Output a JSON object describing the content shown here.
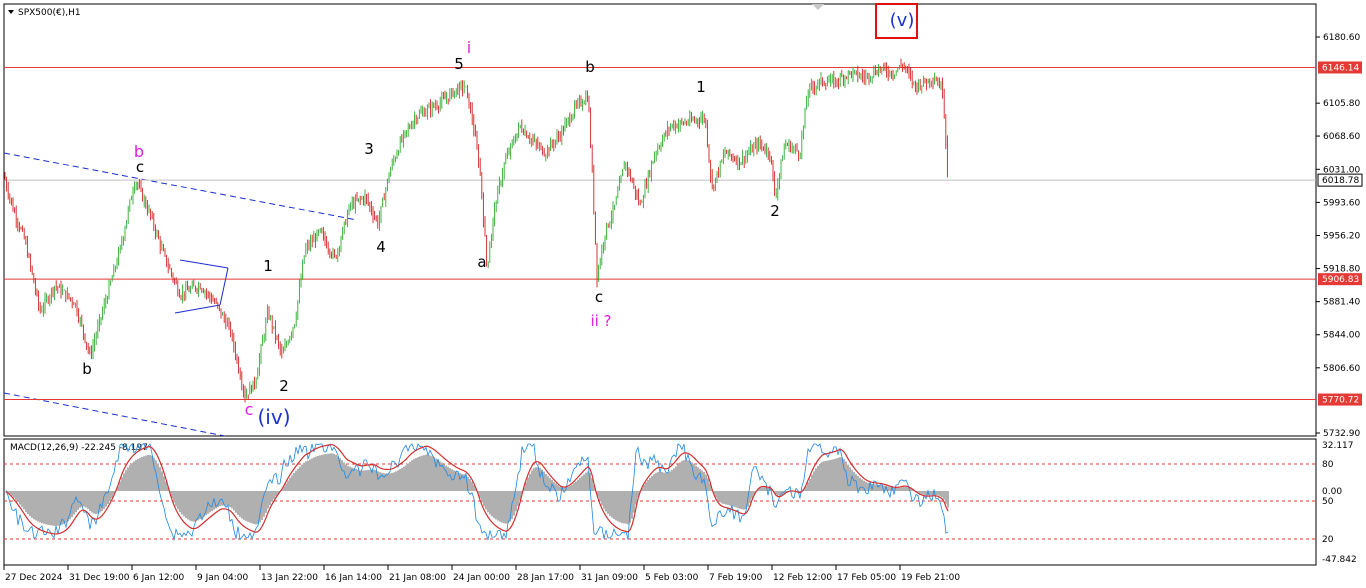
{
  "chart_data": {
    "type": "candlestick",
    "title": "SPX500(€),H1",
    "ylim": [
      5732.9,
      6218.0
    ],
    "y_ticks": [
      "6180.60",
      "6105.80",
      "6068.60",
      "6031.00",
      "5993.60",
      "5956.20",
      "5918.80",
      "5881.40",
      "5844.00",
      "5806.60",
      "5732.90"
    ],
    "y_tick_values": [
      6180.6,
      6105.8,
      6068.6,
      6031.0,
      5993.6,
      5956.2,
      5918.8,
      5881.4,
      5844.0,
      5806.6,
      5732.9
    ],
    "x_labels": [
      "27 Dec 2024",
      "31 Dec 19:00",
      "6 Jan 12:00",
      "9 Jan 04:00",
      "13 Jan 22:00",
      "16 Jan 14:00",
      "21 Jan 08:00",
      "24 Jan 00:00",
      "28 Jan 17:00",
      "31 Jan 09:00",
      "5 Feb 03:00",
      "7 Feb 19:00",
      "12 Feb 12:00",
      "17 Feb 05:00",
      "19 Feb 21:00"
    ],
    "horizontal_levels": [
      {
        "value": 6146.14,
        "label": "6146.14",
        "color": "#e53935"
      },
      {
        "value": 5906.83,
        "label": "5906.83",
        "color": "#e53935"
      },
      {
        "value": 5770.72,
        "label": "5770.72",
        "color": "#e53935"
      }
    ],
    "current_price": {
      "value": 6018.78,
      "label": "6018.78"
    },
    "price_path_approx": [
      [
        0,
        6040
      ],
      [
        12,
        5990
      ],
      [
        25,
        5950
      ],
      [
        40,
        5870
      ],
      [
        55,
        5900
      ],
      [
        75,
        5880
      ],
      [
        90,
        5820
      ],
      [
        105,
        5880
      ],
      [
        120,
        5940
      ],
      [
        135,
        6020
      ],
      [
        150,
        5980
      ],
      [
        165,
        5930
      ],
      [
        180,
        5890
      ],
      [
        200,
        5900
      ],
      [
        215,
        5880
      ],
      [
        230,
        5850
      ],
      [
        245,
        5775
      ],
      [
        255,
        5790
      ],
      [
        268,
        5870
      ],
      [
        282,
        5820
      ],
      [
        295,
        5860
      ],
      [
        305,
        5940
      ],
      [
        320,
        5960
      ],
      [
        335,
        5930
      ],
      [
        350,
        5990
      ],
      [
        365,
        6000
      ],
      [
        378,
        5970
      ],
      [
        390,
        6030
      ],
      [
        400,
        6060
      ],
      [
        415,
        6090
      ],
      [
        430,
        6100
      ],
      [
        445,
        6110
      ],
      [
        455,
        6120
      ],
      [
        465,
        6125
      ],
      [
        472,
        6090
      ],
      [
        480,
        6030
      ],
      [
        487,
        5920
      ],
      [
        495,
        5990
      ],
      [
        505,
        6040
      ],
      [
        520,
        6080
      ],
      [
        535,
        6060
      ],
      [
        545,
        6050
      ],
      [
        560,
        6070
      ],
      [
        575,
        6100
      ],
      [
        588,
        6115
      ],
      [
        592,
        6030
      ],
      [
        597,
        5910
      ],
      [
        605,
        5960
      ],
      [
        615,
        5990
      ],
      [
        625,
        6040
      ],
      [
        640,
        5990
      ],
      [
        655,
        6050
      ],
      [
        670,
        6080
      ],
      [
        690,
        6085
      ],
      [
        705,
        6090
      ],
      [
        712,
        6010
      ],
      [
        725,
        6050
      ],
      [
        740,
        6040
      ],
      [
        758,
        6060
      ],
      [
        770,
        6050
      ],
      [
        775,
        6000
      ],
      [
        785,
        6060
      ],
      [
        800,
        6050
      ],
      [
        808,
        6120
      ],
      [
        820,
        6130
      ],
      [
        835,
        6130
      ],
      [
        850,
        6140
      ],
      [
        865,
        6135
      ],
      [
        880,
        6145
      ],
      [
        893,
        6140
      ],
      [
        903,
        6150
      ],
      [
        915,
        6125
      ],
      [
        925,
        6130
      ],
      [
        935,
        6135
      ],
      [
        943,
        6120
      ],
      [
        948,
        6020
      ]
    ],
    "wave_labels": [
      {
        "text": "(v)",
        "color": "#1a33d0"
      },
      {
        "text": "i",
        "color": "#e020e0"
      },
      {
        "text": "5",
        "color": "#000000"
      },
      {
        "text": "b",
        "color": "#000000"
      },
      {
        "text": "1",
        "color": "#000000"
      },
      {
        "text": "b",
        "color": "#e020e0"
      },
      {
        "text": "c",
        "color": "#000000"
      },
      {
        "text": "3",
        "color": "#000000"
      },
      {
        "text": "4",
        "color": "#000000"
      },
      {
        "text": "2",
        "color": "#000000"
      },
      {
        "text": "a",
        "color": "#000000"
      },
      {
        "text": "c",
        "color": "#000000"
      },
      {
        "text": "ii ?",
        "color": "#e020e0"
      },
      {
        "text": "1",
        "color": "#000000"
      },
      {
        "text": "b",
        "color": "#000000"
      },
      {
        "text": "2",
        "color": "#000000"
      },
      {
        "text": "c",
        "color": "#e020e0"
      },
      {
        "text": "(iv)",
        "color": "#1a33d0"
      }
    ],
    "indicator": {
      "name": "MACD(12,26,9) -22.245 -8.197",
      "ylim": [
        -47.842,
        32.117
      ],
      "ticks": [
        "32.117",
        "80",
        "0.00",
        "50",
        "20",
        "-47.842"
      ],
      "levels": [
        80,
        50,
        20
      ]
    }
  }
}
